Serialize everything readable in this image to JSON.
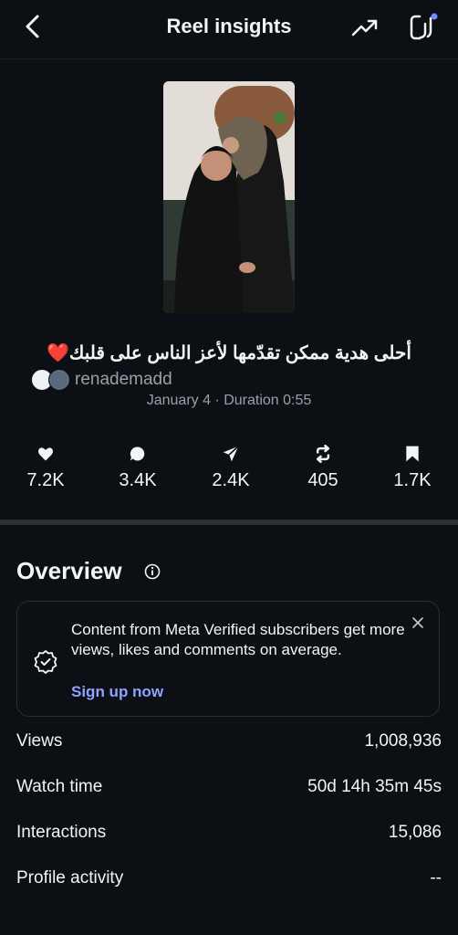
{
  "header": {
    "title": "Reel insights"
  },
  "reel": {
    "caption": "أحلى هدية ممكن تقدّمها لأعز الناس على قلبك❤️",
    "username": "renademadd",
    "meta": "January 4 · Duration 0:55"
  },
  "stats": [
    {
      "icon": "heart-icon",
      "value": "7.2K"
    },
    {
      "icon": "comment-icon",
      "value": "3.4K"
    },
    {
      "icon": "share-icon",
      "value": "2.4K"
    },
    {
      "icon": "repost-icon",
      "value": "405"
    },
    {
      "icon": "bookmark-icon",
      "value": "1.7K"
    }
  ],
  "overview": {
    "title": "Overview",
    "card_text": "Content from Meta Verified subscribers get more views, likes and comments on average.",
    "card_link": "Sign up now"
  },
  "metrics": [
    {
      "label": "Views",
      "value": "1,008,936"
    },
    {
      "label": "Watch time",
      "value": "50d 14h 35m 45s"
    },
    {
      "label": "Interactions",
      "value": "15,086"
    },
    {
      "label": "Profile activity",
      "value": "--"
    }
  ],
  "colors": {
    "background": "#0c0f14",
    "text": "#f4f4f4",
    "muted": "#9aa0a8",
    "link": "#8fa3ff"
  }
}
